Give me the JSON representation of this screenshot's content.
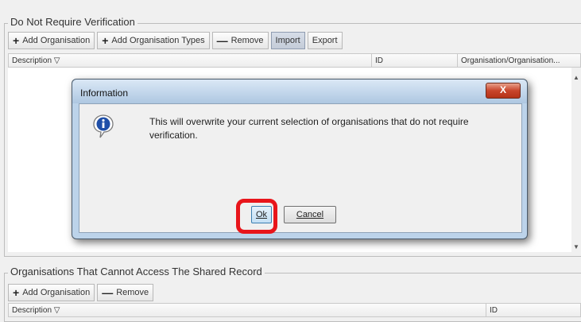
{
  "top_panel": {
    "title": "Do Not Require Verification",
    "toolbar": [
      {
        "symbol": "+",
        "label": "Add Organisation"
      },
      {
        "symbol": "+",
        "label": "Add Organisation Types"
      },
      {
        "symbol": "—",
        "label": "Remove"
      },
      {
        "symbol": "",
        "label": "Import"
      },
      {
        "symbol": "",
        "label": "Export"
      }
    ],
    "columns": [
      "Description ▽",
      "ID",
      "Organisation/Organisation..."
    ]
  },
  "dialog": {
    "title": "Information",
    "close_label": "X",
    "icon": "info-icon",
    "message": "This will overwrite your current selection of organisations that do not require verification.",
    "ok_label": "Ok",
    "cancel_label": "Cancel",
    "highlight_color": "#e8151b"
  },
  "bottom_panel": {
    "title": "Organisations That Cannot Access The Shared Record",
    "toolbar": [
      {
        "symbol": "+",
        "label": "Add Organisation"
      },
      {
        "symbol": "—",
        "label": "Remove"
      }
    ],
    "columns": [
      "Description ▽",
      "ID"
    ]
  }
}
